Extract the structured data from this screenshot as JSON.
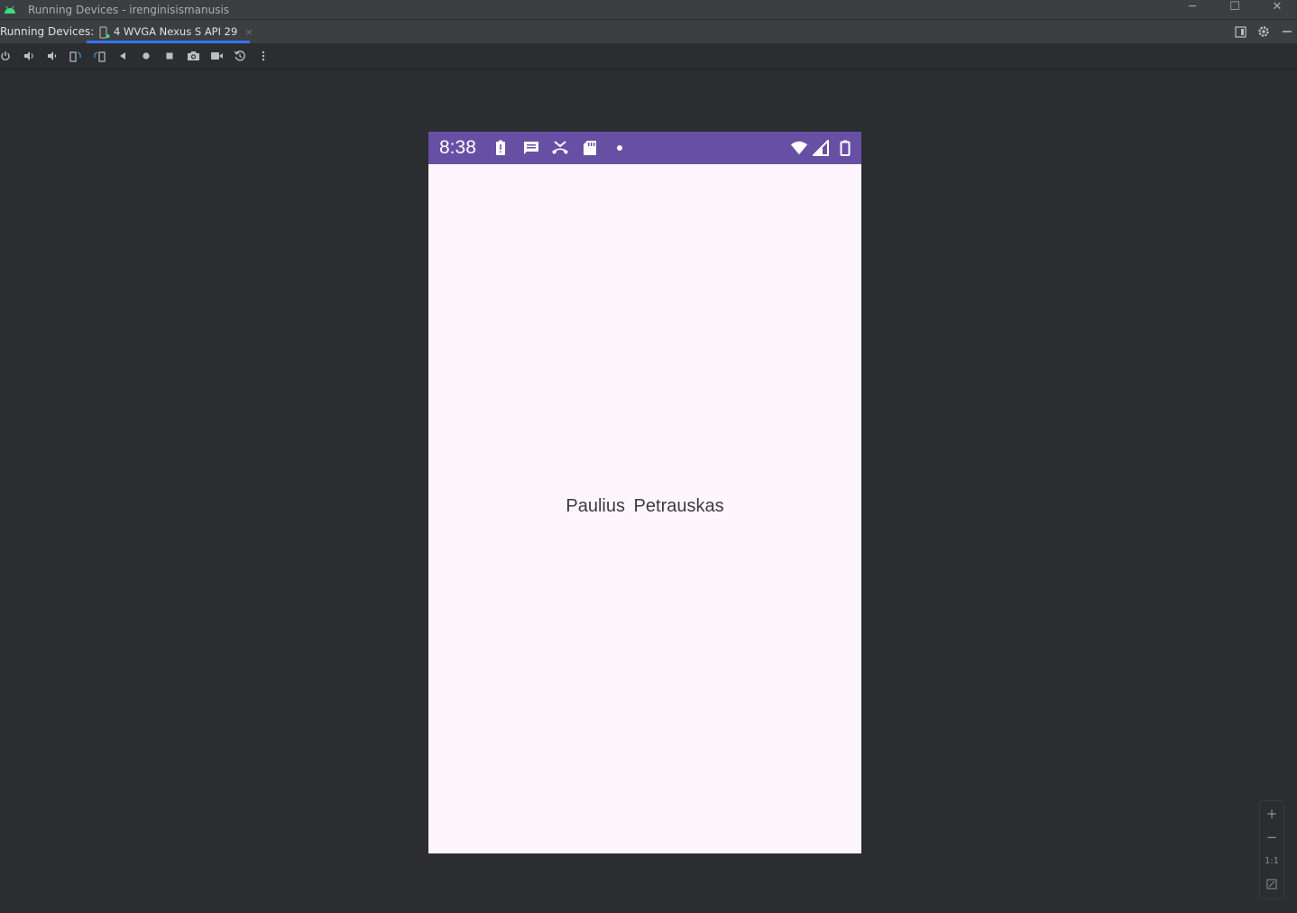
{
  "window": {
    "title": "Running Devices - irenginisismanusis",
    "minimize_label": "─",
    "maximize_label": "☐",
    "close_label": "✕"
  },
  "tabbar": {
    "label": "Running Devices:",
    "tab_label": "4 WVGA Nexus S API 29",
    "tab_close": "×"
  },
  "toolbar": {
    "items": [
      "power",
      "volume-up",
      "volume-down",
      "rotate-left",
      "rotate-right",
      "back",
      "home",
      "overview",
      "screenshot",
      "screen-record",
      "reset",
      "more"
    ]
  },
  "device": {
    "status_time": "8:38",
    "content_text": "Paulius  Petrauskas",
    "status_bar_color": "#6750a4",
    "screen_color": "#fdf7fd"
  },
  "zoom": {
    "zoom_in": "+",
    "zoom_out": "−",
    "actual_size": "1:1"
  },
  "colors": {
    "ide_background": "#2b2d30",
    "tab_underline": "#3574f0",
    "accent_icon": "#3592c4",
    "android_green": "#3ddc84"
  }
}
